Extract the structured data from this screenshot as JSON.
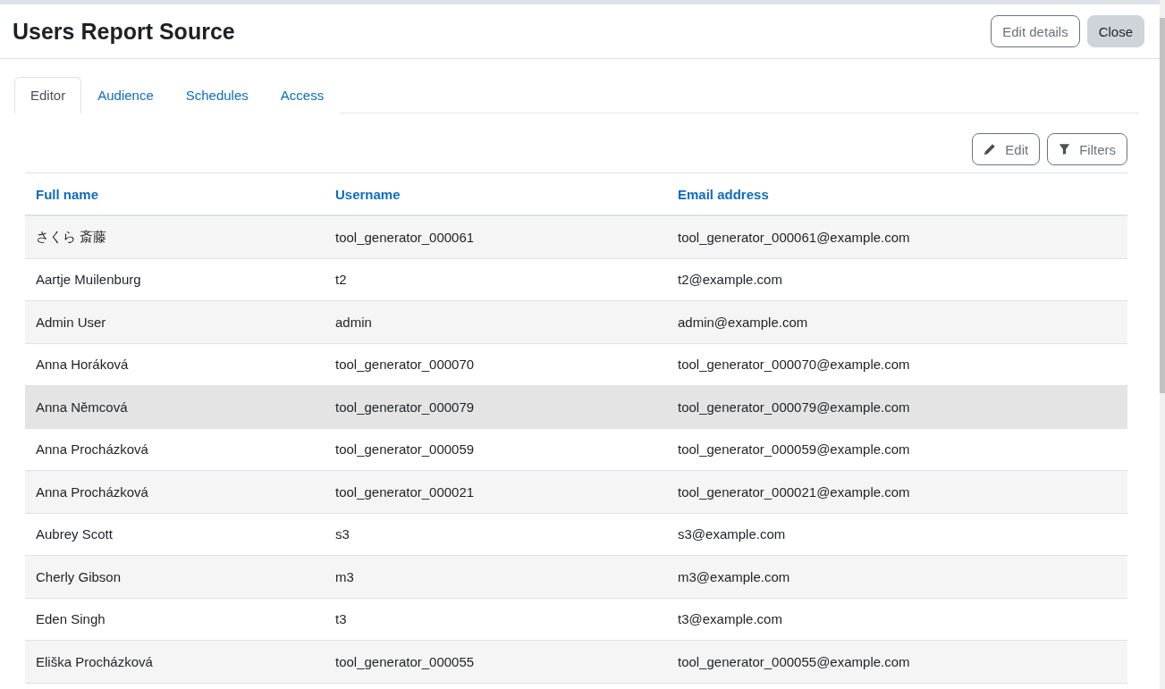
{
  "modal": {
    "title": "Users Report Source",
    "buttons": [
      {
        "label": "Edit details",
        "kind": "outline"
      },
      {
        "label": "Close",
        "kind": "secondary"
      }
    ]
  },
  "tabs": [
    {
      "label": "Editor",
      "selected": true
    },
    {
      "label": "Audience",
      "selected": false
    },
    {
      "label": "Schedules",
      "selected": false
    },
    {
      "label": "Access",
      "selected": false
    }
  ],
  "toolbar": [
    {
      "label": "Edit",
      "kind": "edit"
    },
    {
      "label": "Filters",
      "kind": "filter"
    }
  ],
  "table": {
    "columns": [
      "Full name",
      "Username",
      "Email address"
    ],
    "rows": [
      {
        "cells": [
          "さくら 斎藤",
          "tool_generator_000061",
          "tool_generator_000061@example.com"
        ],
        "hovered": false
      },
      {
        "cells": [
          "Aartje Muilenburg",
          "t2",
          "t2@example.com"
        ],
        "hovered": false
      },
      {
        "cells": [
          "Admin User",
          "admin",
          "admin@example.com"
        ],
        "hovered": false
      },
      {
        "cells": [
          "Anna Horáková",
          "tool_generator_000070",
          "tool_generator_000070@example.com"
        ],
        "hovered": false
      },
      {
        "cells": [
          "Anna Němcová",
          "tool_generator_000079",
          "tool_generator_000079@example.com"
        ],
        "hovered": true
      },
      {
        "cells": [
          "Anna Procházková",
          "tool_generator_000059",
          "tool_generator_000059@example.com"
        ],
        "hovered": false
      },
      {
        "cells": [
          "Anna Procházková",
          "tool_generator_000021",
          "tool_generator_000021@example.com"
        ],
        "hovered": false
      },
      {
        "cells": [
          "Aubrey Scott",
          "s3",
          "s3@example.com"
        ],
        "hovered": false
      },
      {
        "cells": [
          "Cherly Gibson",
          "m3",
          "m3@example.com"
        ],
        "hovered": false
      },
      {
        "cells": [
          "Eden Singh",
          "t3",
          "t3@example.com"
        ],
        "hovered": false
      },
      {
        "cells": [
          "Eliška Procházková",
          "tool_generator_000055",
          "tool_generator_000055@example.com"
        ],
        "hovered": false
      }
    ]
  }
}
